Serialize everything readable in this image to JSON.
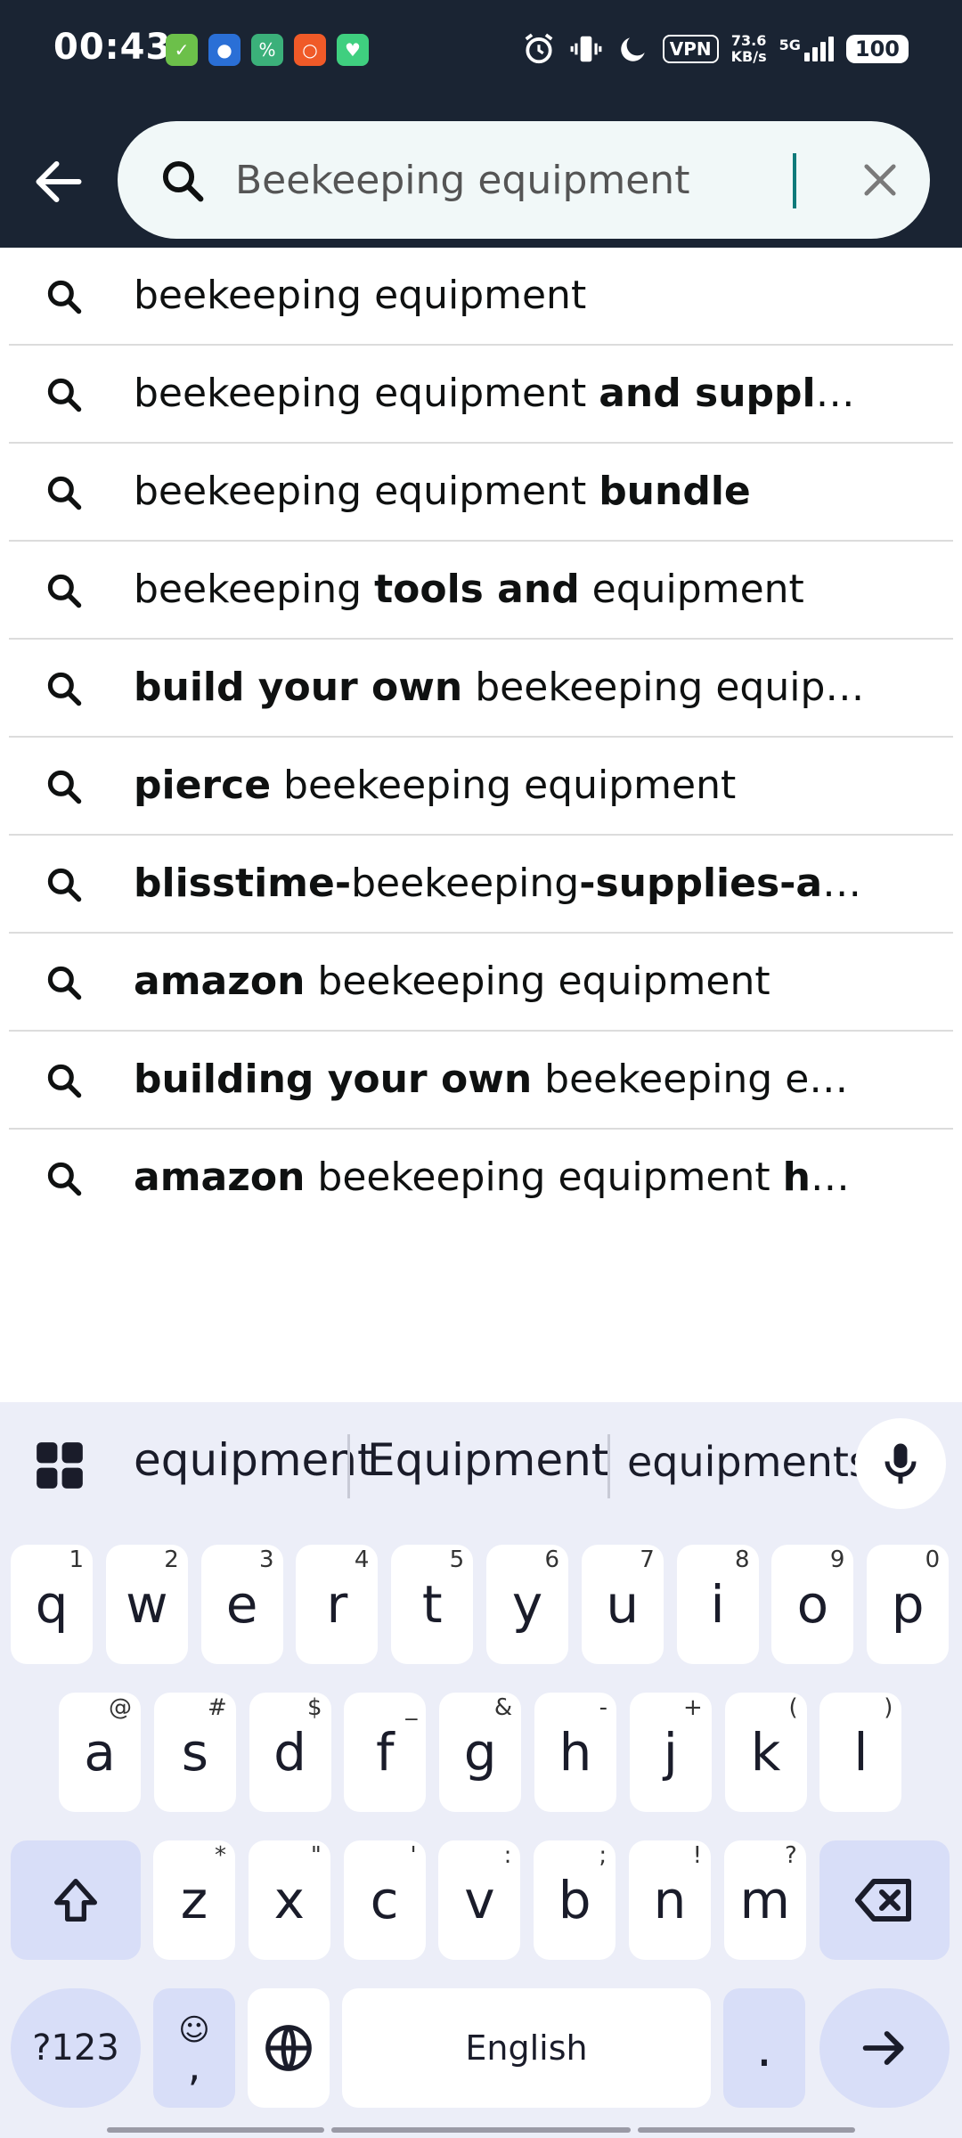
{
  "status_bar": {
    "time": "00:43",
    "vpn": "VPN",
    "speed_value": "73.6",
    "speed_unit": "KB/s",
    "network": "5G",
    "battery": "100"
  },
  "search": {
    "value": "Beekeeping equipment"
  },
  "suggestions": [
    [
      {
        "t": "beekeeping equipment",
        "b": false
      }
    ],
    [
      {
        "t": "beekeeping equipment ",
        "b": false
      },
      {
        "t": "and suppl",
        "b": true
      },
      {
        "t": "…",
        "b": false
      }
    ],
    [
      {
        "t": "beekeeping equipment ",
        "b": false
      },
      {
        "t": "bundle",
        "b": true
      }
    ],
    [
      {
        "t": "beekeeping ",
        "b": false
      },
      {
        "t": "tools and",
        "b": true
      },
      {
        "t": " equipment",
        "b": false
      }
    ],
    [
      {
        "t": "build your own",
        "b": true
      },
      {
        "t": " beekeeping equip…",
        "b": false
      }
    ],
    [
      {
        "t": "pierce",
        "b": true
      },
      {
        "t": " beekeeping equipment",
        "b": false
      }
    ],
    [
      {
        "t": "blisstime-",
        "b": true
      },
      {
        "t": "beekeeping",
        "b": false
      },
      {
        "t": "-supplies-a",
        "b": true
      },
      {
        "t": "…",
        "b": false
      }
    ],
    [
      {
        "t": "amazon",
        "b": true
      },
      {
        "t": " beekeeping equipment",
        "b": false
      }
    ],
    [
      {
        "t": "building your own",
        "b": true
      },
      {
        "t": " beekeeping e…",
        "b": false
      }
    ],
    [
      {
        "t": "amazon",
        "b": true
      },
      {
        "t": " beekeeping equipment ",
        "b": false
      },
      {
        "t": "h",
        "b": true
      },
      {
        "t": "…",
        "b": false
      }
    ]
  ],
  "keyboard": {
    "predictions": [
      "equipment",
      "Equipment",
      "equipments"
    ],
    "row1": [
      [
        "q",
        "1"
      ],
      [
        "w",
        "2"
      ],
      [
        "e",
        "3"
      ],
      [
        "r",
        "4"
      ],
      [
        "t",
        "5"
      ],
      [
        "y",
        "6"
      ],
      [
        "u",
        "7"
      ],
      [
        "i",
        "8"
      ],
      [
        "o",
        "9"
      ],
      [
        "p",
        "0"
      ]
    ],
    "row2": [
      [
        "a",
        "@"
      ],
      [
        "s",
        "#"
      ],
      [
        "d",
        "$"
      ],
      [
        "f",
        "_"
      ],
      [
        "g",
        "&"
      ],
      [
        "h",
        "-"
      ],
      [
        "j",
        "+"
      ],
      [
        "k",
        "("
      ],
      [
        "l",
        ")"
      ]
    ],
    "row3": [
      [
        "z",
        "*"
      ],
      [
        "x",
        "\""
      ],
      [
        "c",
        "'"
      ],
      [
        "v",
        ":"
      ],
      [
        "b",
        ";"
      ],
      [
        "n",
        "!"
      ],
      [
        "m",
        "?"
      ]
    ],
    "symbols_label": "?123",
    "emoji_key": "☺",
    "comma": ",",
    "space_label": "English",
    "period": "."
  },
  "colors": {
    "header_bg": "#1a2433",
    "search_bg": "#f1f8f8",
    "caret": "#0f7a7a",
    "keyboard_bg": "#eceef8",
    "modifier_key": "#d8def8"
  }
}
